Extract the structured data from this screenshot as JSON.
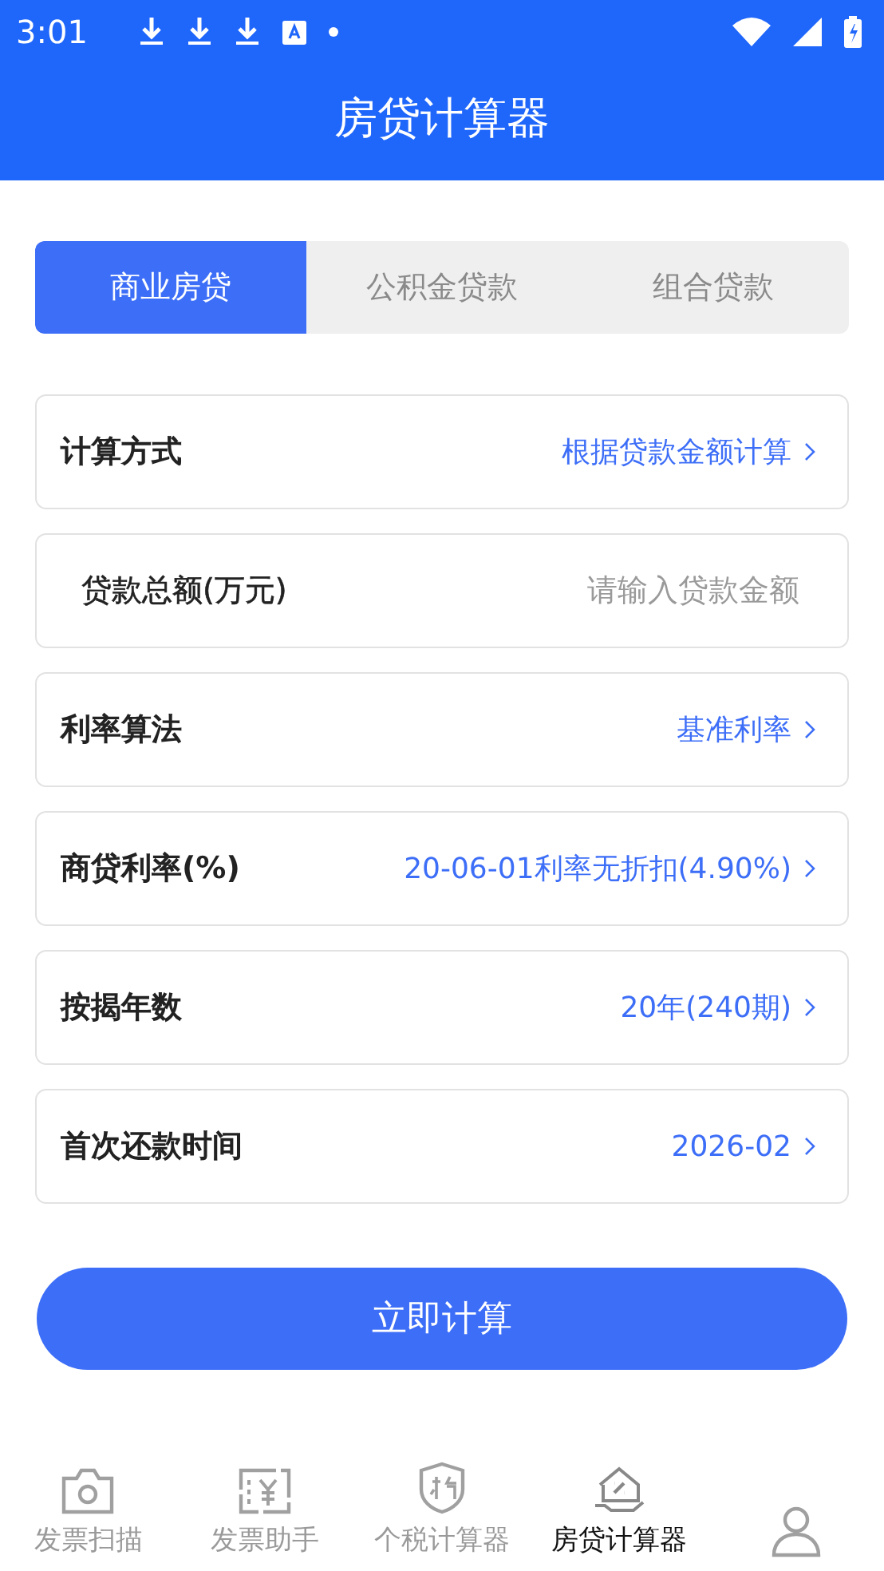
{
  "status_bar": {
    "time": "3:01"
  },
  "header": {
    "title": "房贷计算器"
  },
  "tabs": [
    {
      "label": "商业房贷",
      "selected": true
    },
    {
      "label": "公积金贷款",
      "selected": false
    },
    {
      "label": "组合贷款",
      "selected": false
    }
  ],
  "fields": [
    {
      "kind": "select",
      "label": "计算方式",
      "value": "根据贷款金额计算"
    },
    {
      "kind": "input",
      "label": "贷款总额(万元)",
      "placeholder": "请输入贷款金额"
    },
    {
      "kind": "select",
      "label": "利率算法",
      "value": "基准利率"
    },
    {
      "kind": "select",
      "label": "商贷利率(%)",
      "value": "20-06-01利率无折扣(4.90%)"
    },
    {
      "kind": "select",
      "label": "按揭年数",
      "value": "20年(240期)"
    },
    {
      "kind": "select",
      "label": "首次还款时间",
      "value": "2026-02"
    }
  ],
  "calculate_button": "立即计算",
  "bottom_nav": [
    {
      "kind": "camera",
      "label": "发票扫描",
      "selected": false
    },
    {
      "kind": "invoice",
      "label": "发票助手",
      "selected": false
    },
    {
      "kind": "tax",
      "label": "个税计算器",
      "selected": false
    },
    {
      "kind": "house",
      "label": "房贷计算器",
      "selected": true
    },
    {
      "kind": "person",
      "selected": false
    }
  ]
}
